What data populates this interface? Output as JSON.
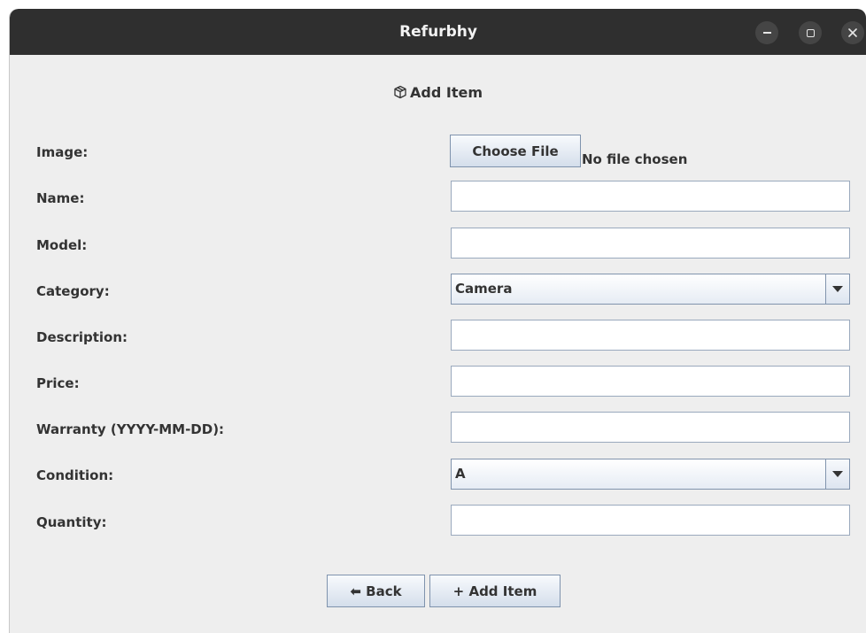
{
  "window": {
    "title": "Refurbhy"
  },
  "form": {
    "heading_icon": "package-icon",
    "heading": "Add Item",
    "image_label": "Image:",
    "choose_file_label": "Choose File",
    "no_file_text": "No file chosen",
    "name_label": "Name:",
    "name_value": "",
    "model_label": "Model:",
    "model_value": "",
    "category_label": "Category:",
    "category_value": "Camera",
    "description_label": "Description:",
    "description_value": "",
    "price_label": "Price:",
    "price_value": "",
    "warranty_label": "Warranty (YYYY-MM-DD):",
    "warranty_value": "",
    "condition_label": "Condition:",
    "condition_value": "A",
    "quantity_label": "Quantity:",
    "quantity_value": ""
  },
  "buttons": {
    "back_label": "⬅ Back",
    "add_label": "+ Add Item"
  }
}
